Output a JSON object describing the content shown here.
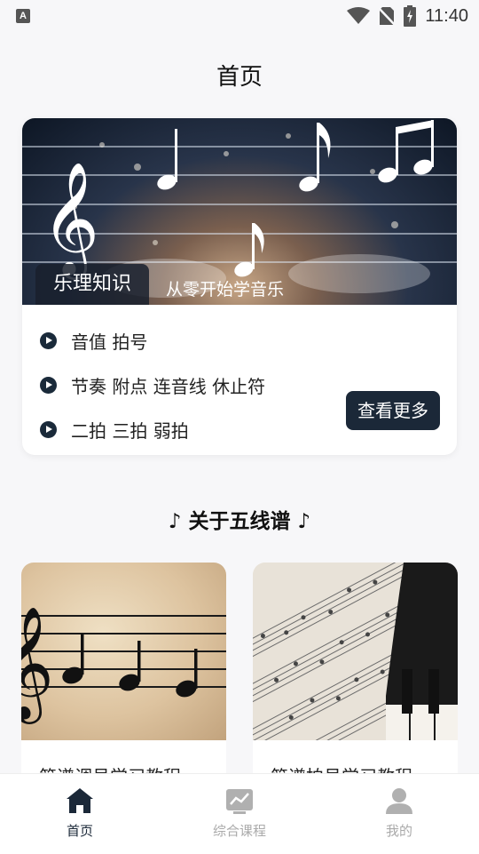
{
  "status_bar": {
    "time": "11:40",
    "notification_icon_letter": "A",
    "icons": [
      "wifi-icon",
      "no-sim-icon",
      "battery-charging-icon"
    ]
  },
  "header": {
    "title": "首页"
  },
  "music_card": {
    "banner_title": "乐理知识",
    "banner_subtitle": "从零开始学音乐",
    "items": [
      {
        "label": "音值 拍号"
      },
      {
        "label": "节奏 附点 连音线 休止符"
      },
      {
        "label": "二拍 三拍 弱拍"
      }
    ],
    "more_button": "查看更多"
  },
  "section": {
    "title": "♪ 关于五线谱 ♪"
  },
  "courses": [
    {
      "title": "简谱调号学习教程"
    },
    {
      "title": "简谱拍号学习教程"
    }
  ],
  "tab_bar": {
    "tabs": [
      {
        "label": "首页",
        "icon": "home-icon",
        "active": true
      },
      {
        "label": "综合课程",
        "icon": "chart-icon",
        "active": false
      },
      {
        "label": "我的",
        "icon": "person-icon",
        "active": false
      }
    ]
  },
  "colors": {
    "accent": "#1b2838",
    "background": "#f7f7f9",
    "tab_inactive": "#aaaaaa"
  }
}
